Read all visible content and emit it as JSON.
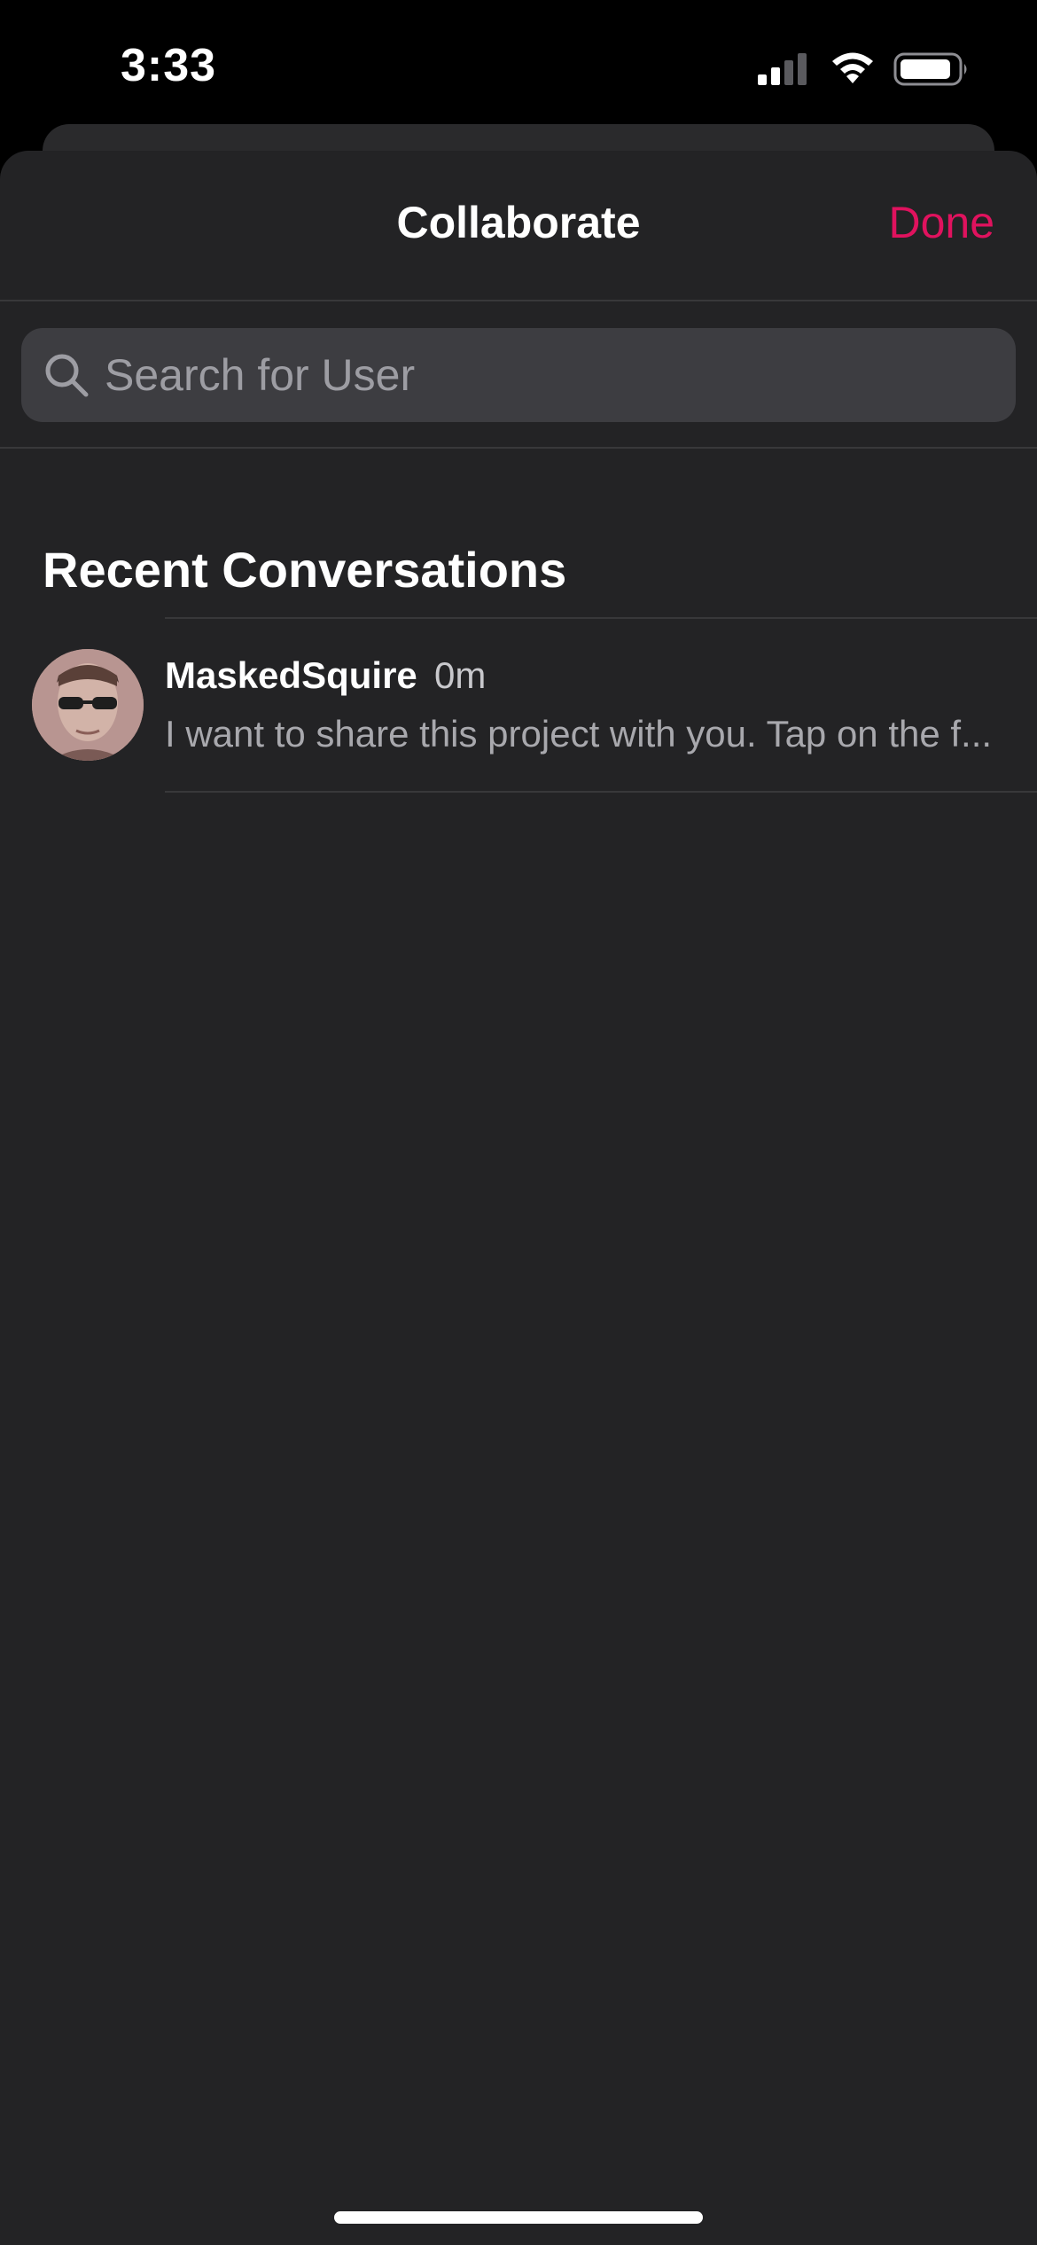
{
  "status_bar": {
    "time": "3:33",
    "signal_icon": "cellular-signal-icon",
    "wifi_icon": "wifi-icon",
    "battery_icon": "battery-icon"
  },
  "nav": {
    "title": "Collaborate",
    "done_label": "Done"
  },
  "search": {
    "placeholder": "Search for User",
    "value": "",
    "icon": "search-icon"
  },
  "recent": {
    "section_title": "Recent Conversations",
    "conversations": [
      {
        "name": "MaskedSquire",
        "time": "0m",
        "preview": "I want to share this project with you. Tap on the f..."
      }
    ]
  },
  "colors": {
    "accent": "#e0125e",
    "sheet_background": "#232325",
    "search_background": "#3d3d41",
    "divider": "#38383a"
  }
}
